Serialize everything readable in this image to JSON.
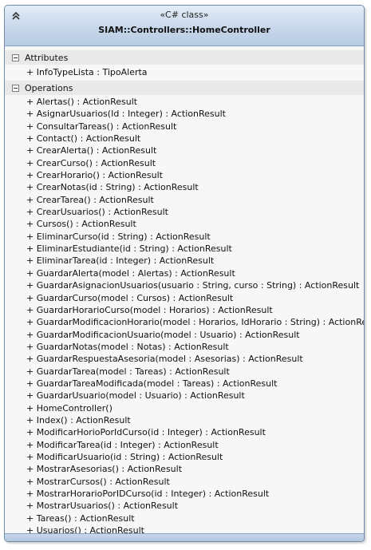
{
  "header": {
    "stereotype": "«C# class»",
    "class_name": "SIAM::Controllers::HomeController"
  },
  "attributes": {
    "label": "Attributes",
    "items": [
      "+ InfoTypeLista : TipoAlerta"
    ]
  },
  "operations": {
    "label": "Operations",
    "items": [
      "+ Alertas() : ActionResult",
      "+ AsignarUsuarios(Id : Integer) : ActionResult",
      "+ ConsultarTareas() : ActionResult",
      "+ Contact() : ActionResult",
      "+ CrearAlerta() : ActionResult",
      "+ CrearCurso() : ActionResult",
      "+ CrearHorario() : ActionResult",
      "+ CrearNotas(id : String) : ActionResult",
      "+ CrearTarea() : ActionResult",
      "+ CrearUsuarios() : ActionResult",
      "+ Cursos() : ActionResult",
      "+ EliminarCurso(id : String) : ActionResult",
      "+ EliminarEstudiante(id : String) : ActionResult",
      "+ EliminarTarea(id : Integer) : ActionResult",
      "+ GuardarAlerta(model : Alertas) : ActionResult",
      "+ GuardarAsignacionUsuarios(usuario : String, curso : String) : ActionResult",
      "+ GuardarCurso(model : Cursos) : ActionResult",
      "+ GuardarHorarioCurso(model : Horarios) : ActionResult",
      "+ GuardarModificacionHorario(model : Horarios, IdHorario : String) : ActionResult",
      "+ GuardarModificacionUsuario(model : Usuario) : ActionResult",
      "+ GuardarNotas(model : Notas) : ActionResult",
      "+ GuardarRespuestaAsesoria(model : Asesorias) : ActionResult",
      "+ GuardarTarea(model : Tareas) : ActionResult",
      "+ GuardarTareaModificada(model : Tareas) : ActionResult",
      "+ GuardarUsuario(model : Usuario) : ActionResult",
      "+ HomeController()",
      "+ Index() : ActionResult",
      "+ ModificarHorioPorIdCurso(id : Integer) : ActionResult",
      "+ ModificarTarea(id : Integer) : ActionResult",
      "+ ModificarUsuario(id : String) : ActionResult",
      "+ MostrarAsesorias() : ActionResult",
      "+ MostrarCursos() : ActionResult",
      "+ MostrarHorarioPorIDCurso(id : Integer) : ActionResult",
      "+ MostrarUsuarios() : ActionResult",
      "+ Tareas() : ActionResult",
      "+ Usuarios() : ActionResult"
    ]
  }
}
